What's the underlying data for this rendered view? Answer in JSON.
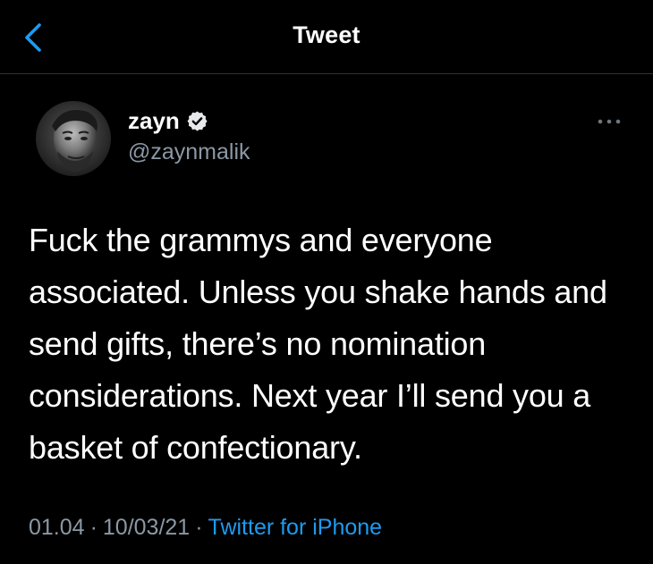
{
  "header": {
    "title": "Tweet",
    "back_icon": "chevron-left-icon"
  },
  "colors": {
    "background": "#000000",
    "accent": "#1d9bf0",
    "secondary_text": "#8b98a5",
    "divider": "#2f3336"
  },
  "tweet": {
    "author": {
      "display_name": "zayn",
      "handle": "@zaynmalik",
      "verified_icon": "verified-badge-icon"
    },
    "more_icon": "more-horizontal-icon",
    "text": "Fuck the grammys and everyone associated. Unless you shake hands and send gifts, there’s no nomination considerations. Next year I’ll send you a basket of confectionary.",
    "time": "01.04",
    "separator": "·",
    "date": "10/03/21",
    "source": "Twitter for iPhone"
  }
}
